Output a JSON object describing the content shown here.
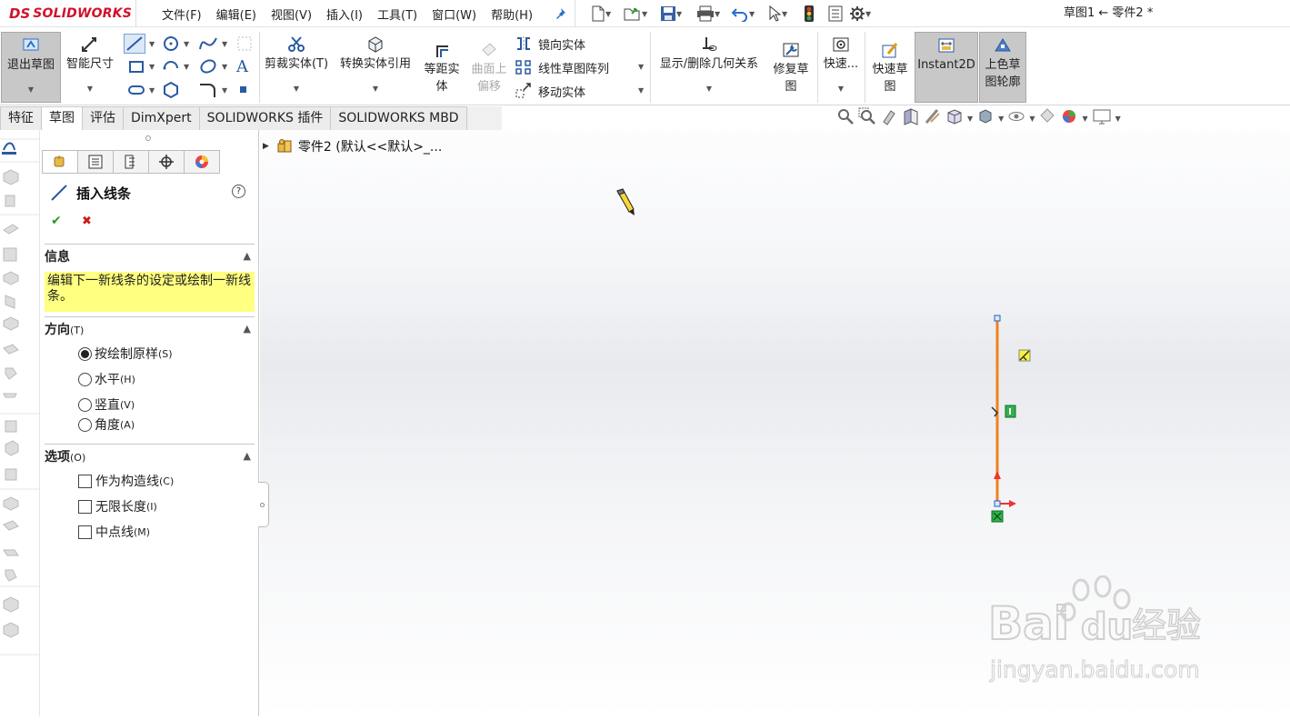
{
  "app": {
    "logo_ds": "DS",
    "logo_text": "SOLIDWORKS",
    "document_title": "草图1 ← 零件2 *"
  },
  "menu": [
    "文件(F)",
    "编辑(E)",
    "视图(V)",
    "插入(I)",
    "工具(T)",
    "窗口(W)",
    "帮助(H)"
  ],
  "ribbon": {
    "exit_sketch": "退出草图",
    "smart_dim": "智能尺寸",
    "trim": "剪裁实体(T)",
    "convert": "转换实体引用",
    "offset_l1": "等距实",
    "offset_l2": "体",
    "surface_l1": "曲面上",
    "surface_l2": "偏移",
    "mirror": "镜向实体",
    "linear_pattern": "线性草图阵列",
    "move": "移动实体",
    "relations": "显示/删除几何关系",
    "repair_l1": "修复草",
    "repair_l2": "图",
    "quick_snap": "快速...",
    "quick_sketch_l1": "快速草",
    "quick_sketch_l2": "图",
    "instant2d": "Instant2D",
    "shaded_l1": "上色草",
    "shaded_l2": "图轮廓"
  },
  "tabs": [
    "特征",
    "草图",
    "评估",
    "DimXpert",
    "SOLIDWORKS 插件",
    "SOLIDWORKS MBD"
  ],
  "active_tab": "草图",
  "property_manager": {
    "title": "插入线条",
    "help": "?",
    "ok_icon": "✔",
    "cancel_icon": "✖",
    "info": {
      "heading": "信息",
      "text": "编辑下一新线条的设定或绘制一新线条。"
    },
    "orientation": {
      "heading": "方向",
      "heading_key": "(T)",
      "options": [
        {
          "label": "按绘制原样",
          "key": "(S)",
          "selected": true
        },
        {
          "label": "水平",
          "key": "(H)",
          "selected": false
        },
        {
          "label": "竖直",
          "key": "(V)",
          "selected": false
        },
        {
          "label": "角度",
          "key": "(A)",
          "selected": false
        }
      ]
    },
    "options": {
      "heading": "选项",
      "heading_key": "(O)",
      "items": [
        {
          "label": "作为构造线",
          "key": "(C)",
          "checked": false
        },
        {
          "label": "无限长度",
          "key": "(I)",
          "checked": false
        },
        {
          "label": "中点线",
          "key": "(M)",
          "checked": false
        }
      ]
    }
  },
  "tree": {
    "root_label": "零件2 (默认<<默认>_..."
  },
  "watermark": {
    "brand": "Bai",
    "brand2": "du",
    "cn": "经验",
    "url": "jingyan.baidu.com"
  },
  "colors": {
    "accent": "#1e6fbf",
    "sketch_line": "#f0821e",
    "info_bg": "#ffff80",
    "brand_red": "#d0122c"
  }
}
